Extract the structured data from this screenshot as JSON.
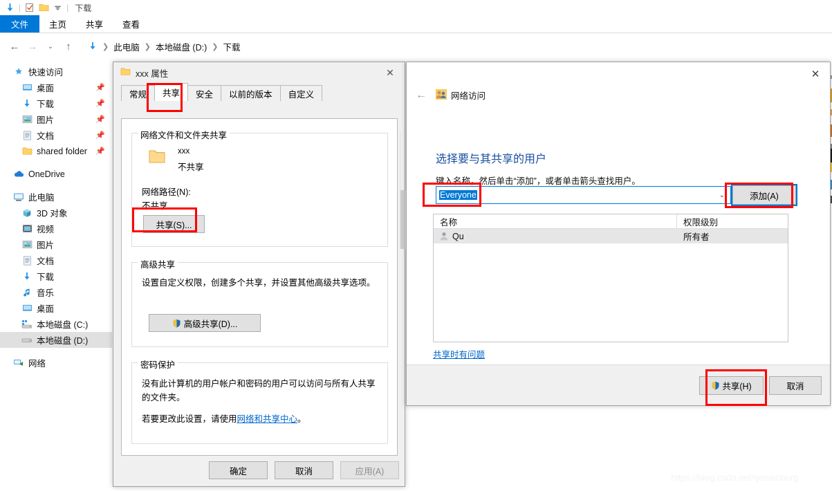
{
  "explorer": {
    "quick_access_toolbar": {
      "icons": [
        "downloads-arrow-icon",
        "properties-checkmark-icon",
        "new-folder-icon",
        "dropdown-caret-icon"
      ],
      "title": "下载"
    },
    "ribbon_tabs": [
      {
        "label": "文件",
        "active": true
      },
      {
        "label": "主页",
        "active": false
      },
      {
        "label": "共享",
        "active": false
      },
      {
        "label": "查看",
        "active": false
      }
    ],
    "address_bar": {
      "back_icon": "back-arrow-icon",
      "forward_icon": "forward-arrow-icon",
      "recent_icon": "chevron-down-icon",
      "up_icon": "up-arrow-icon",
      "crumb_icon": "downloads-arrow-icon",
      "crumbs": [
        "此电脑",
        "本地磁盘 (D:)",
        "下载"
      ]
    },
    "sidebar": {
      "groups": [
        {
          "header": {
            "label": "快速访问",
            "icon": "star-pin-icon"
          },
          "items": [
            {
              "label": "桌面",
              "icon": "desktop-icon",
              "pinned": true
            },
            {
              "label": "下载",
              "icon": "downloads-arrow-icon",
              "pinned": true
            },
            {
              "label": "图片",
              "icon": "pictures-icon",
              "pinned": true
            },
            {
              "label": "文档",
              "icon": "documents-icon",
              "pinned": true
            },
            {
              "label": "shared folder",
              "icon": "folder-icon",
              "pinned": true
            }
          ]
        },
        {
          "header": {
            "label": "OneDrive",
            "icon": "onedrive-cloud-icon"
          },
          "items": []
        },
        {
          "header": {
            "label": "此电脑",
            "icon": "this-pc-icon"
          },
          "items": [
            {
              "label": "3D 对象",
              "icon": "3d-objects-icon",
              "pinned": false
            },
            {
              "label": "视频",
              "icon": "videos-icon",
              "pinned": false
            },
            {
              "label": "图片",
              "icon": "pictures-icon",
              "pinned": false
            },
            {
              "label": "文档",
              "icon": "documents-icon",
              "pinned": false
            },
            {
              "label": "下载",
              "icon": "downloads-arrow-icon",
              "pinned": false
            },
            {
              "label": "音乐",
              "icon": "music-note-icon",
              "pinned": false
            },
            {
              "label": "桌面",
              "icon": "desktop-icon",
              "pinned": false
            },
            {
              "label": "本地磁盘 (C:)",
              "icon": "system-drive-icon",
              "pinned": false
            },
            {
              "label": "本地磁盘 (D:)",
              "icon": "drive-icon",
              "pinned": false,
              "selected": true
            }
          ]
        },
        {
          "header": {
            "label": "网络",
            "icon": "network-icon"
          },
          "items": []
        }
      ]
    }
  },
  "properties_dialog": {
    "title": "xxx 属性",
    "title_icon": "folder-icon",
    "close_icon": "close-icon",
    "tabs": [
      {
        "label": "常规",
        "active": false
      },
      {
        "label": "共享",
        "active": true,
        "highlighted": true
      },
      {
        "label": "安全",
        "active": false
      },
      {
        "label": "以前的版本",
        "active": false
      },
      {
        "label": "自定义",
        "active": false
      }
    ],
    "network_share_group": {
      "legend": "网络文件和文件夹共享",
      "folder_icon": "folder-icon",
      "folder_name": "xxx",
      "folder_state": "不共享",
      "path_label": "网络路径(N):",
      "path_value": "不共享",
      "share_button": "共享(S)...",
      "share_button_highlighted": true
    },
    "advanced_share_group": {
      "legend": "高级共享",
      "description": "设置自定义权限，创建多个共享，并设置其他高级共享选项。",
      "button_label": "高级共享(D)...",
      "button_icon": "uac-shield-icon"
    },
    "password_group": {
      "legend": "密码保护",
      "paragraph1": "没有此计算机的用户帐户和密码的用户可以访问与所有人共享的文件夹。",
      "paragraph2_prefix": "若要更改此设置，请使用",
      "paragraph2_link": "网络和共享中心",
      "paragraph2_suffix": "。"
    },
    "footer_buttons": [
      {
        "label": "确定",
        "disabled": false
      },
      {
        "label": "取消",
        "disabled": false
      },
      {
        "label": "应用(A)",
        "disabled": true
      }
    ]
  },
  "network_access_dialog": {
    "close_icon": "close-icon",
    "back_icon": "back-arrow-icon",
    "header_icon": "network-users-icon",
    "header_label": "网络访问",
    "heading": "选择要与其共享的用户",
    "subtext": "键入名称，然后单击“添加”，或者单击箭头查找用户。",
    "combo": {
      "value": "Everyone",
      "value_selected": true,
      "arrow_icon": "chevron-down-icon",
      "highlighted": true
    },
    "add_button": {
      "label": "添加(A)",
      "highlighted": true,
      "focused": true
    },
    "table": {
      "columns": [
        "名称",
        "权限级别"
      ],
      "rows": [
        {
          "icon": "user-icon",
          "name": "Qu",
          "permission": "所有者"
        }
      ]
    },
    "trouble_link": "共享时有问题",
    "footer_buttons": [
      {
        "label": "共享(H)",
        "icon": "uac-shield-icon",
        "highlighted": true
      },
      {
        "label": "取消",
        "icon": null,
        "highlighted": false
      }
    ]
  },
  "watermark": "https://blog.csdn.net/qeisenberg",
  "colors": {
    "accent_blue": "#0078d7",
    "annotation_red": "#ff0000",
    "heading_blue": "#1a4fa0",
    "link_blue": "#0066cc",
    "selection_gray": "#e0e0e0",
    "dialog_gray": "#f0f0f0"
  }
}
